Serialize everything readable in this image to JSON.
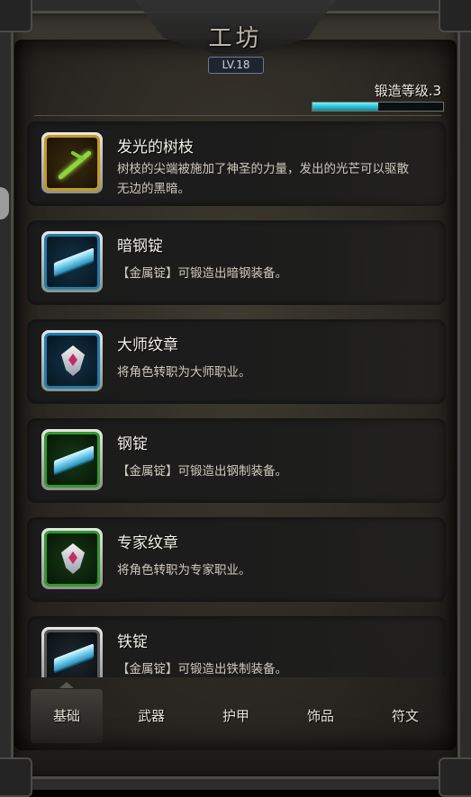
{
  "header": {
    "title": "工坊",
    "level": "LV.18"
  },
  "forge": {
    "label": "锻造等级.3",
    "progress": 0.5
  },
  "items": [
    {
      "name": "发光的树枝",
      "desc": "树枝的尖端被施加了神圣的力量，发出的光芒可以驱散无边的黑暗。",
      "icon": "glowing-branch-icon",
      "frame": "gold"
    },
    {
      "name": "暗钢锭",
      "desc": "【金属锭】可锻造出暗钢装备。",
      "icon": "dark-steel-ingot-icon",
      "frame": "blue"
    },
    {
      "name": "大师纹章",
      "desc": "将角色转职为大师职业。",
      "icon": "master-emblem-icon",
      "frame": "blue"
    },
    {
      "name": "钢锭",
      "desc": "【金属锭】可锻造出钢制装备。",
      "icon": "steel-ingot-icon",
      "frame": "green"
    },
    {
      "name": "专家纹章",
      "desc": "将角色转职为专家职业。",
      "icon": "expert-emblem-icon",
      "frame": "green"
    },
    {
      "name": "铁锭",
      "desc": "【金属锭】可锻造出铁制装备。",
      "icon": "iron-ingot-icon",
      "frame": "none"
    }
  ],
  "tabs": [
    {
      "label": "基础",
      "active": true
    },
    {
      "label": "武器",
      "active": false
    },
    {
      "label": "护甲",
      "active": false
    },
    {
      "label": "饰品",
      "active": false
    },
    {
      "label": "符文",
      "active": false
    }
  ]
}
